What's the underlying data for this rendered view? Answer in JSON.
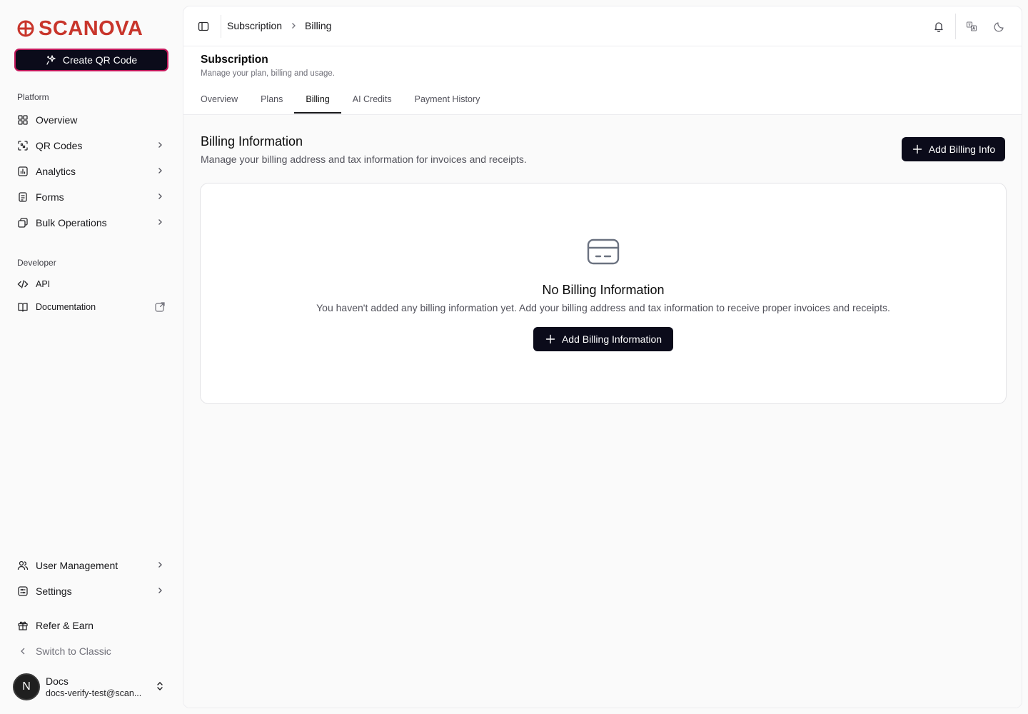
{
  "app": {
    "brand": "SCANOVA",
    "brand_color": "#c8352b",
    "accent": "#0b0b1a"
  },
  "sidebar": {
    "create_button": "Create QR Code",
    "platform_label": "Platform",
    "platform_items": [
      {
        "label": "Overview",
        "icon": "grid-icon",
        "has_chevron": false
      },
      {
        "label": "QR Codes",
        "icon": "qr-scan-icon",
        "has_chevron": true
      },
      {
        "label": "Analytics",
        "icon": "chart-icon",
        "has_chevron": true
      },
      {
        "label": "Forms",
        "icon": "form-icon",
        "has_chevron": true
      },
      {
        "label": "Bulk Operations",
        "icon": "layers-icon",
        "has_chevron": true
      }
    ],
    "developer_label": "Developer",
    "developer_items": [
      {
        "label": "API",
        "icon": "code-icon"
      },
      {
        "label": "Documentation",
        "icon": "book-icon"
      }
    ],
    "bottom_items": [
      {
        "label": "User Management",
        "icon": "users-icon"
      },
      {
        "label": "Settings",
        "icon": "settings-icon"
      }
    ],
    "refer": "Refer & Earn",
    "switch_classic": "Switch to Classic",
    "user": {
      "initial": "N",
      "name": "Docs",
      "email": "docs-verify-test@scan..."
    }
  },
  "topbar": {
    "breadcrumb": [
      "Subscription",
      "Billing"
    ]
  },
  "header": {
    "title": "Subscription",
    "subtitle": "Manage your plan, billing and usage.",
    "tabs": [
      "Overview",
      "Plans",
      "Billing",
      "AI Credits",
      "Payment History"
    ],
    "active_tab": "Billing"
  },
  "billing": {
    "title": "Billing Information",
    "description": "Manage your billing address and tax information for invoices and receipts.",
    "add_button": "Add Billing Info",
    "empty": {
      "title": "No Billing Information",
      "description": "You haven't added any billing information yet. Add your billing address and tax information to receive proper invoices and receipts.",
      "button": "Add Billing Information"
    }
  }
}
